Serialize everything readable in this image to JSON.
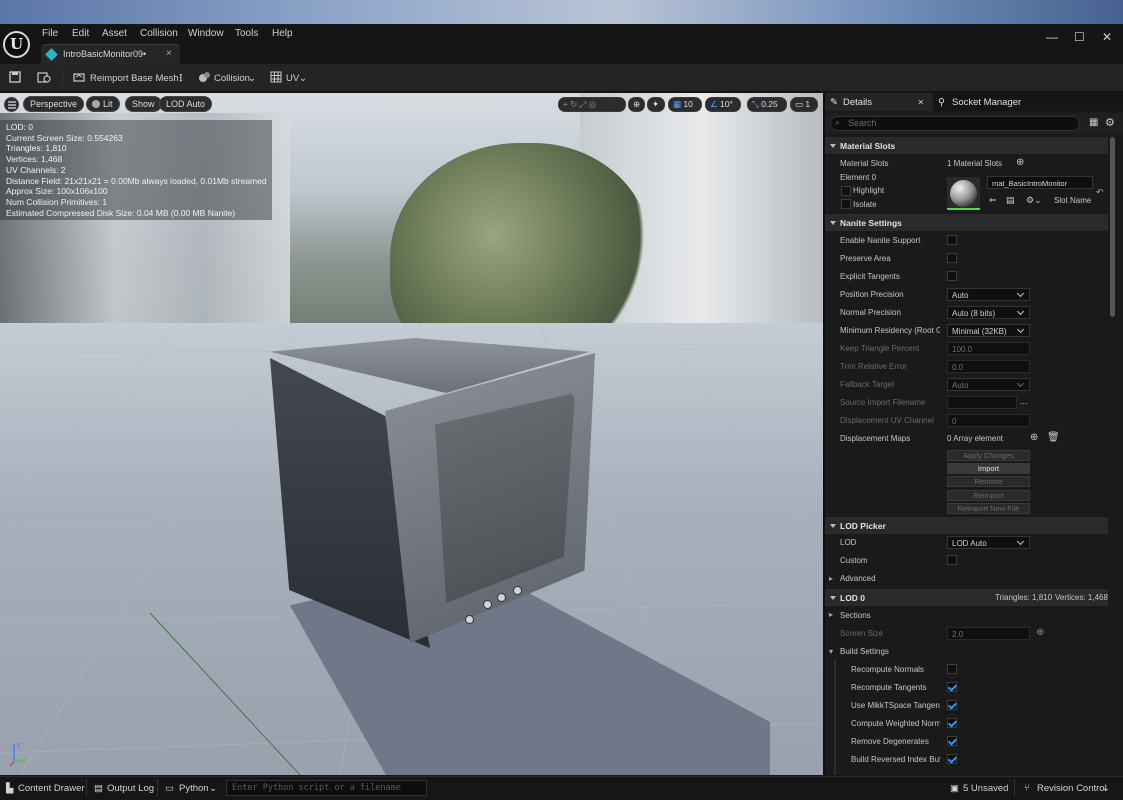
{
  "menu": [
    "File",
    "Edit",
    "Asset",
    "Collision",
    "Window",
    "Tools",
    "Help"
  ],
  "document_tab": {
    "label": "IntroBasicMonitor09•",
    "close": "×"
  },
  "window_controls": {
    "minimize": "—",
    "maximize": "☐",
    "close": "✕"
  },
  "toolbar": {
    "reimport": "Reimport Base Mesh",
    "collision": "Collision",
    "uv": "UV"
  },
  "viewport": {
    "menu_icon": "hamburger-icon",
    "buttons": [
      "Perspective",
      "Lit",
      "Show",
      "LOD Auto"
    ],
    "grid_value": "10",
    "angle_value": "10°",
    "scale_value": "0.25",
    "camera_value": "1",
    "stats": [
      "LOD:  0",
      "Current Screen Size:  0.554263",
      "Triangles:  1,810",
      "Vertices:  1,468",
      "UV Channels:  2",
      "Distance Field:  21x21x21 = 0.00Mb always loaded, 0.01Mb streamed",
      "Approx Size: 100x106x100",
      "Num Collision Primitives:  1",
      "Estimated Compressed Disk Size: 0.04 MB (0.00 MB Nanite)"
    ]
  },
  "details": {
    "tab": "Details",
    "tab_close": "×",
    "socket_tab": "Socket Manager",
    "search_placeholder": "Search",
    "material_slots": {
      "header": "Material Slots",
      "label": "Material Slots",
      "count": "1 Material Slots",
      "element": "Element 0",
      "highlight": "Highlight",
      "isolate": "Isolate",
      "material_name": "mat_BasicIntroMonitor",
      "slot_name": "Slot Name"
    },
    "nanite": {
      "header": "Nanite Settings",
      "enable": "Enable Nanite Support",
      "preserve_area": "Preserve Area",
      "explicit_tangents": "Explicit Tangents",
      "position_precision": "Position Precision",
      "position_precision_value": "Auto",
      "normal_precision": "Normal Precision",
      "normal_precision_value": "Auto (8 bits)",
      "min_residency": "Minimum Residency (Root Ge",
      "min_residency_value": "Minimal (32KB)",
      "keep_triangle": "Keep Triangle Percent",
      "keep_triangle_value": "100.0",
      "trim_error": "Trim Relative Error",
      "trim_error_value": "0.0",
      "fallback_target": "Fallback Target",
      "fallback_target_value": "Auto",
      "source_import": "Source Import Filename",
      "source_import_more": "...",
      "displacement_uv": "Displacement UV Channel",
      "displacement_uv_value": "0",
      "displacement_maps": "Displacement Maps",
      "displacement_maps_value": "0 Array element",
      "buttons": [
        "Apply Changes",
        "Import",
        "Remove",
        "Reimport",
        "Reimport New File"
      ]
    },
    "lod_picker": {
      "header": "LOD Picker",
      "lod": "LOD",
      "lod_value": "LOD Auto",
      "custom": "Custom",
      "advanced": "Advanced"
    },
    "lod0": {
      "header": "LOD 0",
      "triangles": "Triangles: 1,810",
      "vertices": "Vertices: 1,468",
      "sections": "Sections",
      "screen_size": "Screen Size",
      "screen_size_value": "2.0"
    },
    "build_settings": {
      "header": "Build Settings",
      "items": [
        {
          "label": "Recompute Normals",
          "checked": false
        },
        {
          "label": "Recompute Tangents",
          "checked": true
        },
        {
          "label": "Use MikkTSpace Tangent",
          "checked": true
        },
        {
          "label": "Compute Weighted Norma",
          "checked": true
        },
        {
          "label": "Remove Degenerates",
          "checked": true
        },
        {
          "label": "Build Reversed Index Buff",
          "checked": true
        }
      ]
    }
  },
  "statusbar": {
    "content_drawer": "Content Drawer",
    "output_log": "Output Log",
    "python": "Python",
    "python_placeholder": "Enter Python script or a filename",
    "unsaved": "5 Unsaved",
    "revision_control": "Revision Control"
  },
  "colors": {
    "accent": "#3b8ff0",
    "material_outline": "#4dd84d",
    "tab_icon": "#2ab5c8"
  }
}
